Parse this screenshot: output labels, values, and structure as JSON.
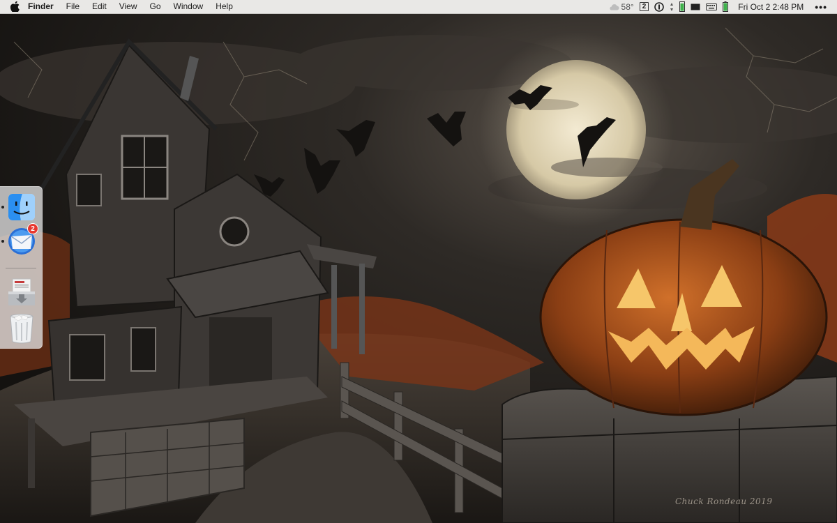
{
  "menubar": {
    "app_name": "Finder",
    "items": [
      "File",
      "Edit",
      "View",
      "Go",
      "Window",
      "Help"
    ],
    "status": {
      "temperature": "58°",
      "desktop_number": "2",
      "clock": "Fri Oct 2  2:48 PM"
    }
  },
  "dock": {
    "items": [
      {
        "name": "Finder",
        "icon": "finder-icon",
        "running": true
      },
      {
        "name": "Mail",
        "icon": "mail-icon",
        "running": true,
        "badge": "2"
      },
      {
        "name": "Downloads",
        "icon": "downloads-stack-icon",
        "running": false
      },
      {
        "name": "Trash",
        "icon": "trash-icon",
        "running": false
      }
    ]
  },
  "wallpaper": {
    "signature": "Chuck Rondeau 2019"
  },
  "colors": {
    "menubar_bg": "#e9e8e6",
    "badge_red": "#e8382f",
    "moon": "#e8dcc0",
    "pumpkin": "#b8581c"
  }
}
